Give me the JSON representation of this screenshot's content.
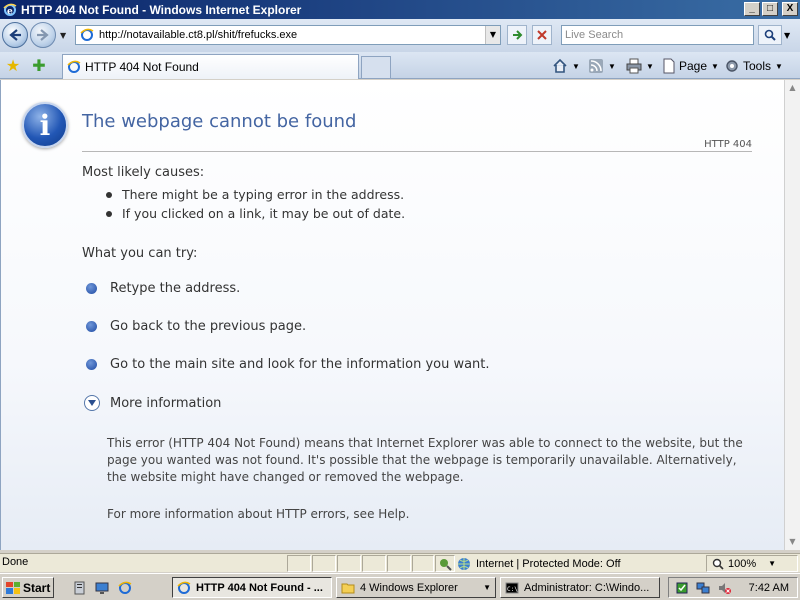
{
  "window": {
    "title": "HTTP 404 Not Found - Windows Internet Explorer",
    "controls": {
      "minimize": "_",
      "maximize": "□",
      "close": "X"
    }
  },
  "address_bar": {
    "url": "http://notavailable.ct8.pl/shit/frefucks.exe",
    "search_placeholder": "Live Search"
  },
  "tabs": [
    {
      "label": "HTTP 404 Not Found",
      "active": true
    }
  ],
  "command_bar": {
    "page_label": "Page",
    "tools_label": "Tools"
  },
  "page": {
    "heading": "The webpage cannot be found",
    "http_code": "HTTP 404",
    "causes_title": "Most likely causes:",
    "causes": [
      "There might be a typing error in the address.",
      "If you clicked on a link, it may be out of date."
    ],
    "try_title": "What you can try:",
    "try_items": [
      "Retype the address.",
      "Go back to the previous page.",
      "Go to the main site and look for the information you want."
    ],
    "more_info_label": "More information",
    "more_info_text": "This error (HTTP 404 Not Found) means that Internet Explorer was able to connect to the website, but the page you wanted was not found. It's possible that the webpage is temporarily unavailable. Alternatively, the website might have changed or removed the webpage.",
    "help_text": "For more information about HTTP errors, see Help."
  },
  "status_bar": {
    "status": "Done",
    "zone": "Internet | Protected Mode: Off",
    "zoom": "100%"
  },
  "taskbar": {
    "start_label": "Start",
    "buttons": [
      {
        "label": "HTTP 404 Not Found - ...",
        "active": true
      },
      {
        "label": "4 Windows Explorer",
        "active": false
      },
      {
        "label": "Administrator: C:\\Windo...",
        "active": false
      }
    ],
    "clock": "7:42 AM"
  },
  "colors": {
    "heading": "#4465a2",
    "title_bar_start": "#0a246a",
    "title_bar_end": "#3a6ea5"
  }
}
